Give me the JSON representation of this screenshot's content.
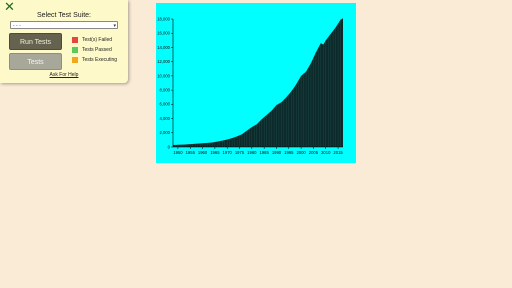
{
  "panel": {
    "close_icon": "close-x-icon",
    "title": "Select Test Suite:",
    "select_value": "- - -",
    "run_label": "Run Tests",
    "tests_label": "Tests",
    "help_label": "Ask For Help",
    "legend": [
      {
        "label": "Test(s) Failed",
        "color": "#e8463c"
      },
      {
        "label": "Tests Passed",
        "color": "#5cc95c"
      },
      {
        "label": "Tests Executing",
        "color": "#f0a818"
      }
    ]
  },
  "chart_data": {
    "type": "area",
    "title": "",
    "xlabel": "",
    "ylabel": "",
    "xlim": [
      1948,
      2017
    ],
    "ylim": [
      0,
      18000
    ],
    "x_ticks": [
      "1950",
      "1955",
      "1960",
      "1965",
      "1970",
      "1975",
      "1980",
      "1985",
      "1990",
      "1995",
      "2000",
      "2005",
      "2010",
      "2015"
    ],
    "y_ticks": [
      "0",
      "2,000",
      "4,000",
      "6,000",
      "8,000",
      "10,000",
      "12,000",
      "14,000",
      "16,000",
      "18,000"
    ],
    "background": "#00ffff",
    "fill": "#0c2a2a",
    "x": [
      1948,
      1952,
      1956,
      1960,
      1964,
      1968,
      1970,
      1972,
      1974,
      1976,
      1978,
      1980,
      1982,
      1984,
      1986,
      1988,
      1990,
      1992,
      1994,
      1996,
      1998,
      2000,
      2002,
      2004,
      2006,
      2008,
      2009,
      2010,
      2012,
      2014,
      2016,
      2017
    ],
    "values": [
      280,
      340,
      420,
      530,
      640,
      900,
      1050,
      1250,
      1500,
      1800,
      2300,
      2800,
      3200,
      3900,
      4500,
      5100,
      5900,
      6300,
      7000,
      7800,
      8800,
      10000,
      10600,
      11800,
      13300,
      14600,
      14400,
      15000,
      15900,
      16800,
      17900,
      18100
    ]
  }
}
